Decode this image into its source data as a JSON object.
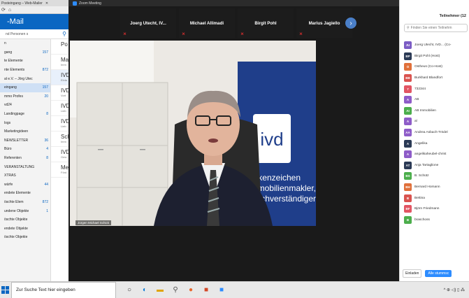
{
  "mail": {
    "browser_tab": "Posteingang – Web-Mailer",
    "title": "-Mail",
    "search_placeholder": "nd Personen s",
    "folders": [
      {
        "label": "n",
        "count": ""
      },
      {
        "label": "gang",
        "count": "157"
      },
      {
        "label": "te Elemente",
        "count": ""
      },
      {
        "label": "nte Elements",
        "count": "872"
      },
      {
        "label": "al e.V. – Jörg Utec",
        "count": ""
      },
      {
        "label": "eingang",
        "count": "157"
      },
      {
        "label": "mmo Profes",
        "count": "20"
      },
      {
        "label": "vd24",
        "count": ""
      },
      {
        "label": "Landingpage",
        "count": "8"
      },
      {
        "label": "logs",
        "count": ""
      },
      {
        "label": "Marketingideen",
        "count": ""
      },
      {
        "label": "NEWSLETTER",
        "count": "36"
      },
      {
        "label": "Büro",
        "count": "4"
      },
      {
        "label": "Referenten",
        "count": "8"
      },
      {
        "label": "VERANSTALTUNG",
        "count": ""
      },
      {
        "label": "XTRAS",
        "count": ""
      },
      {
        "label": "würfe",
        "count": "44"
      },
      {
        "label": "endete Elemente",
        "count": ""
      },
      {
        "label": "öschte Elem",
        "count": "872"
      },
      {
        "label": "undene Objekte",
        "count": "1"
      },
      {
        "label": "öschte Objekte",
        "count": ""
      },
      {
        "label": "endete Objekte",
        "count": ""
      },
      {
        "label": "öschte Objekte",
        "count": ""
      }
    ],
    "messages": [
      {
        "head": "Po",
        "sub": ""
      },
      {
        "head": "Ma",
        "sub": "Imm"
      },
      {
        "head": "IVD",
        "sub": "Einla"
      },
      {
        "head": "IVD",
        "sub": "Vort"
      },
      {
        "head": "IVD",
        "sub": "Lieb"
      },
      {
        "head": "IVD",
        "sub": "Lieb"
      },
      {
        "head": "Sch",
        "sub": "Imm"
      },
      {
        "head": "IVD",
        "sub": "Gew"
      },
      {
        "head": "Me",
        "sub": "Förd"
      }
    ]
  },
  "zoom": {
    "window_title": "Zoom Meeting",
    "thumbnails": [
      "Joerg Utecht, IV...",
      "Michael Allimadi",
      "Birgit Pohl",
      "Marius Jagiello"
    ],
    "speaker_label": "Jürgen Michael Schick",
    "background_text": {
      "logo": "ivd",
      "line1": "Markenzeichen",
      "line2": "Immobilienmakler,",
      "line3": "Sachverständiger"
    }
  },
  "participants": {
    "title": "Teilnehmer (12",
    "search_placeholder": "Finden Sie einen Teilnehm",
    "list": [
      {
        "initials": "JU",
        "name": "Joerg Utecht, IVD... (Co-",
        "color": "#7b5cc4"
      },
      {
        "initials": "BP",
        "name": "Birgit Pohl (Host)",
        "color": "#2b3a55"
      },
      {
        "initials": "O",
        "name": "Ostheus (Co-Host)",
        "color": "#e0703a"
      },
      {
        "initials": "BB",
        "name": "Burkhard Blandfort",
        "color": "#d9534f"
      },
      {
        "initials": "7",
        "name": "732344",
        "color": "#e25563"
      },
      {
        "initials": "A",
        "name": "AB",
        "color": "#8e5cc8"
      },
      {
        "initials": "AI",
        "name": "AB Immobilien",
        "color": "#4cae4c"
      },
      {
        "initials": "A",
        "name": "al",
        "color": "#8e5cc8"
      },
      {
        "initials": "AA",
        "name": "Andrea Asbach-Trödel",
        "color": "#8e5cc8"
      },
      {
        "initials": "A",
        "name": "Angelika",
        "color": "#2b3a55"
      },
      {
        "initials": "A",
        "name": "angelikaheubel-christ",
        "color": "#8e5cc8"
      },
      {
        "initials": "AT",
        "name": "Anja Tartaglione",
        "color": "#2b3a55"
      },
      {
        "initials": "BS",
        "name": "B. Schütz",
        "color": "#4cae4c"
      },
      {
        "initials": "BH",
        "name": "Bernard Homann",
        "color": "#e0703a"
      },
      {
        "initials": "B",
        "name": "Bettina",
        "color": "#d9534f"
      },
      {
        "initials": "BF",
        "name": "Björn Friedmann",
        "color": "#e25563"
      },
      {
        "initials": "B",
        "name": "braschoss",
        "color": "#4cae4c"
      }
    ],
    "invite_label": "Einladen",
    "mute_all_label": "Alle stummsc"
  },
  "taskbar": {
    "search_text": "Zur Suche Text hier eingeben",
    "apps": [
      "search-app-icon",
      "edge-icon",
      "explorer-icon",
      "search-app-icon-2",
      "firefox-icon",
      "powerpoint-icon",
      "zoom-icon"
    ],
    "tray": "^ ⊕ ◁) ▯ ⁂"
  }
}
